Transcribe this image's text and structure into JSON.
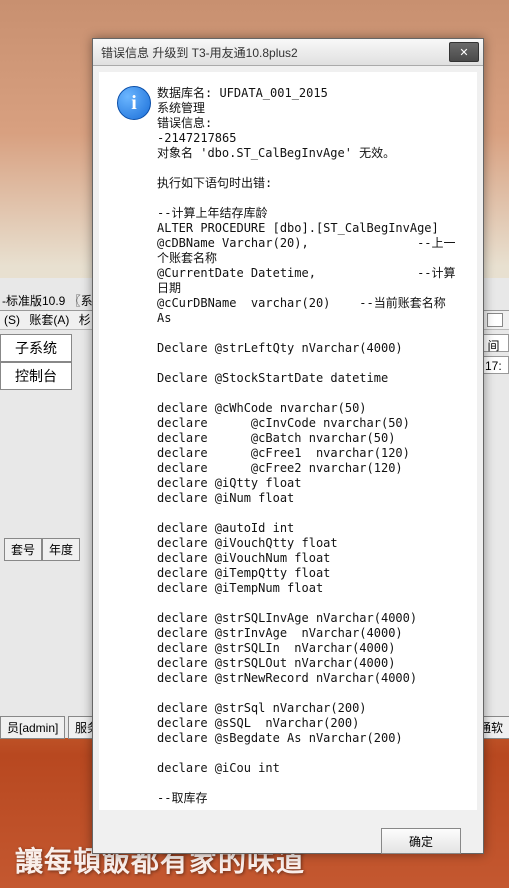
{
  "bg": {
    "bottomText": "讓每頓飯都有家的味道",
    "appTitle": "-标准版10.9 〖系",
    "menuItems": [
      "(S)",
      "账套(A)",
      "杉"
    ],
    "cells": [
      "子系统",
      "控制台"
    ],
    "rightCell": "间",
    "rightVal": "17:",
    "statusLeft": "套号",
    "statusLeft2": "年度",
    "statusUser": "员[admin]",
    "statusSvc": "服务",
    "statusRight": "通软"
  },
  "dialog": {
    "title": "错误信息  升级到 T3-用友通10.8plus2",
    "message": "数据库名: UFDATA_001_2015\n系统管理\n错误信息:\n-2147217865\n对象名 'dbo.ST_CalBegInvAge' 无效。\n\n执行如下语句时出错:\n\n--计算上年结存库龄\nALTER PROCEDURE [dbo].[ST_CalBegInvAge]\n@cDBName Varchar(20),               --上一个账套名称\n@CurrentDate Datetime,              --计算日期\n@cCurDBName  varchar(20)    --当前账套名称\nAs\n\nDeclare @strLeftQty nVarchar(4000)\n\nDeclare @StockStartDate datetime\n\ndeclare @cWhCode nvarchar(50)\ndeclare      @cInvCode nvarchar(50)\ndeclare      @cBatch nvarchar(50)\ndeclare      @cFree1  nvarchar(120)\ndeclare      @cFree2 nvarchar(120)\ndeclare @iQtty float\ndeclare @iNum float\n\ndeclare @autoId int\ndeclare @iVouchQtty float\ndeclare @iVouchNum float\ndeclare @iTempQtty float\ndeclare @iTempNum float\n\ndeclare @strSQLInvAge nVarchar(4000)\ndeclare @strInvAge  nVarchar(4000)\ndeclare @strSQLIn  nVarchar(4000)\ndeclare @strSQLOut nVarchar(4000)\ndeclare @strNewRecord nVarchar(4000)\n\ndeclare @strSql nVarchar(200)\ndeclare @sSQL  nVarchar(200)\ndeclare @sBegdate As nVarchar(200)\n\ndeclare @iCou int\n\n--取库存",
    "ok": "确定"
  }
}
